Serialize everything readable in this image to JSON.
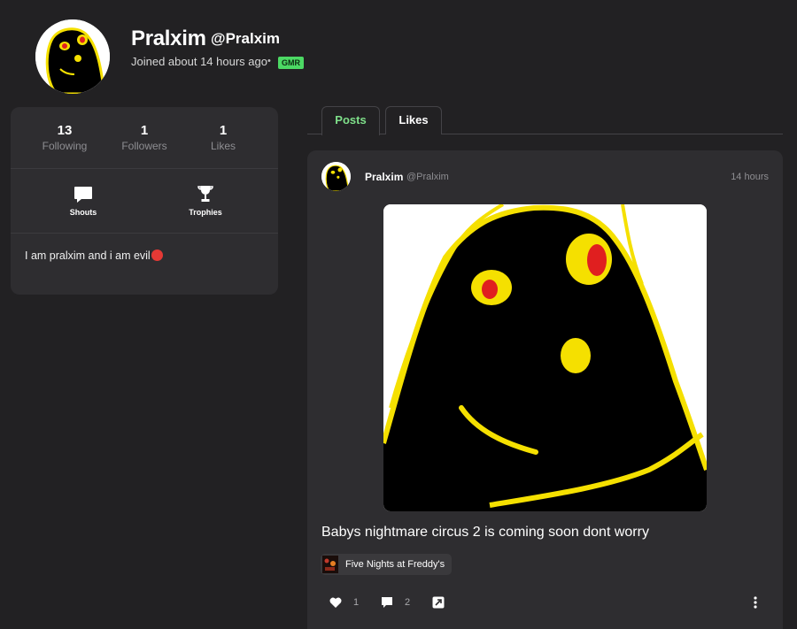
{
  "profile": {
    "display_name": "Pralxim",
    "handle": "@Pralxim",
    "joined": "Joined about 14 hours ago",
    "separator": "•",
    "badge": "GMR",
    "badge_color": "#4cd964"
  },
  "stats": [
    {
      "value": "13",
      "label": "Following"
    },
    {
      "value": "1",
      "label": "Followers"
    },
    {
      "value": "1",
      "label": "Likes"
    }
  ],
  "tiles": [
    {
      "label": "Shouts",
      "icon": "chat-bubble-icon"
    },
    {
      "label": "Trophies",
      "icon": "trophy-icon"
    }
  ],
  "bio": {
    "text": "I am pralxim and i am evil",
    "emoji": "devil-face-emoji"
  },
  "tabs": [
    {
      "label": "Posts",
      "active": true,
      "color": "#7fe08a"
    },
    {
      "label": "Likes",
      "active": false
    }
  ],
  "post": {
    "author": "Pralxim",
    "handle": "@Pralxim",
    "time": "14 hours",
    "text": "Babys nightmare circus 2 is coming soon dont worry",
    "game_tag": "Five Nights at Freddy's",
    "likes": "1",
    "comments": "2",
    "icons": {
      "like": "heart-icon",
      "comment": "comment-icon",
      "share": "share-icon",
      "more": "more-vertical-icon"
    }
  }
}
